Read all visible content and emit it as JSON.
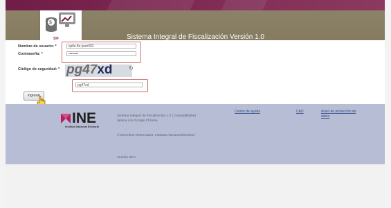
{
  "header": {
    "logo_label": "SIF",
    "title": "Sistema Integral de Fiscalización Versión 1.0"
  },
  "form": {
    "username_label": "Nombre de usuario: *",
    "username_value": "sptle.fle.pum002",
    "password_label": "Contraseña: *",
    "password_value": "••••••••",
    "security_label": "Código de seguridad: *",
    "captcha_text_prefix": "pg47",
    "captcha_text_suffix": "xd",
    "captcha_input_value": "pg47xd",
    "submit_label": "Ingresar"
  },
  "footer": {
    "org_name": "INE",
    "org_subtitle": "Instituto Nacional Electoral",
    "line1": "Sistema Integral de Fiscalización 1.0 | Compatibilidad",
    "line2": "óptima con Google Chrome",
    "rights": "© Derechos Reservados, Instituto Nacional Electoral",
    "version": "Versión 30.0",
    "help_link": "Centro de ayuda",
    "cau_link": "CAU",
    "privacy_link_line1": "Aviso de protección de",
    "privacy_link_line2": "datos"
  },
  "colors": {
    "topbar": "#7e2952",
    "header": "#857b60",
    "footer": "#b7bdd4",
    "accent": "#8a2150"
  },
  "icons": {
    "logo": "database-monitor-icon",
    "cursor": "hand-pointer-icon",
    "refresh": "refresh-icon"
  }
}
